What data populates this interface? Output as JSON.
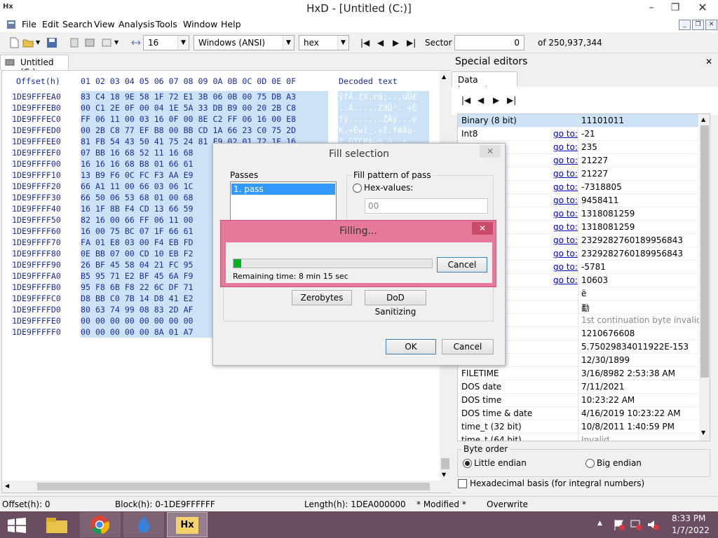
{
  "window": {
    "title": "HxD - [Untitled (C:)]",
    "app_icon_text": "Hx",
    "min": "–",
    "max": "❐",
    "close": "✕"
  },
  "menu": [
    "File",
    "Edit",
    "Search",
    "View",
    "Analysis",
    "Tools",
    "Window",
    "Help"
  ],
  "toolbar": {
    "bytes_per_row": "16",
    "charset": "Windows (ANSI)",
    "offset_base": "hex",
    "sector_label": "Sector",
    "sector_value": "0",
    "sector_total": "of 250,937,344"
  },
  "doc_tab": "Untitled (C:)",
  "hex": {
    "header_offset": "Offset(h)",
    "header_cols": "01 02 03 04 05 06 07 08 09 0A 0B 0C 0D 0E 0F",
    "header_decoded": "Decoded text",
    "rows": [
      {
        "off": "1DE9FFFEA0",
        "hex": "83 C4 18 9E 58 1F 72 E1 3B 06 0B 00 75 DB A3",
        "txt": "ÿfÄ.žX.rá;...uÛ£"
      },
      {
        "off": "1DE9FFFEB0",
        "hex": "00 C1 2E 0F 00 04 1E 5A 33 DB B9 00 20 2B C8",
        "txt": "..Á.....Z3Û¹. +È"
      },
      {
        "off": "1DE9FFFEC0",
        "hex": "FF 06 11 00 03 16 0F 00 8E C2 FF 06 16 00 E8",
        "txt": "fÿ.......ŽÂÿ...è"
      },
      {
        "off": "1DE9FFFED0",
        "hex": "00 2B C8 77 EF B8 00 BB CD 1A 66 23 C0 75 2D",
        "txt": "K.+Èwï¸.»Í.f#Àu-"
      },
      {
        "off": "1DE9FFFEE0",
        "hex": "81 FB 54 43 50 41 75 24 81 F9 02 01 72 1E 16",
        "txt": "f.ûTCPAu$.ù..r.."
      },
      {
        "off": "1DE9FFFEF0",
        "hex": "07 BB 16 68 52 11 16 68",
        "txt": ""
      },
      {
        "off": "1DE9FFFF00",
        "hex": "16 16 16 68 B8 01 66 61",
        "txt": ""
      },
      {
        "off": "1DE9FFFF10",
        "hex": "13 B9 F6 0C FC F3 AA E9",
        "txt": ""
      },
      {
        "off": "1DE9FFFF20",
        "hex": "66 A1 11 00 66 03 06 1C",
        "txt": ""
      },
      {
        "off": "1DE9FFFF30",
        "hex": "66 50 06 53 68 01 00 68",
        "txt": ""
      },
      {
        "off": "1DE9FFFF40",
        "hex": "16 1F 8B F4 CD 13 66 59",
        "txt": ""
      },
      {
        "off": "1DE9FFFF50",
        "hex": "82 16 00 66 FF 06 11 00",
        "txt": ""
      },
      {
        "off": "1DE9FFFF60",
        "hex": "16 00 75 BC 07 1F 66 61",
        "txt": ""
      },
      {
        "off": "1DE9FFFF70",
        "hex": "FA 01 E8 03 00 F4 EB FD",
        "txt": ""
      },
      {
        "off": "1DE9FFFF80",
        "hex": "0E BB 07 00 CD 10 EB F2",
        "txt": ""
      },
      {
        "off": "1DE9FFFF90",
        "hex": "26 BF 45 58 04 21 FC 95",
        "txt": ""
      },
      {
        "off": "1DE9FFFFA0",
        "hex": "B5 95 71 E2 BF 45 6A F9",
        "txt": ""
      },
      {
        "off": "1DE9FFFFB0",
        "hex": "95 F8 6B F8 22 6C DF 71",
        "txt": ""
      },
      {
        "off": "1DE9FFFFC0",
        "hex": "D8 BB C0 7B 14 D8 41 E2",
        "txt": ""
      },
      {
        "off": "1DE9FFFFD0",
        "hex": "80 63 74 99 08 83 2D AF",
        "txt": ""
      },
      {
        "off": "1DE9FFFFE0",
        "hex": "00 00 00 00 00 00 00 00",
        "txt": ""
      },
      {
        "off": "1DE9FFFFF0",
        "hex": "00 00 00 00 00 8A 01 A7",
        "txt": ""
      }
    ]
  },
  "special": {
    "title": "Special editors",
    "close": "✕",
    "tab": "Data inspector"
  },
  "inspector": {
    "goto": "go to:",
    "rows": [
      {
        "name": "Binary (8 bit)",
        "goto": false,
        "value": "11101011"
      },
      {
        "name": "Int8",
        "goto": true,
        "value": "-21"
      },
      {
        "name": "",
        "goto": true,
        "value": "235"
      },
      {
        "name": "",
        "goto": true,
        "value": "21227"
      },
      {
        "name": "",
        "goto": true,
        "value": "21227"
      },
      {
        "name": "",
        "goto": true,
        "value": "-7318805"
      },
      {
        "name": "",
        "goto": true,
        "value": "9458411"
      },
      {
        "name": "",
        "goto": true,
        "value": "1318081259"
      },
      {
        "name": "",
        "goto": true,
        "value": "1318081259"
      },
      {
        "name": "",
        "goto": true,
        "value": "2329282760189956843"
      },
      {
        "name": "",
        "goto": true,
        "value": "2329282760189956843"
      },
      {
        "name": "",
        "goto": true,
        "value": "-5781"
      },
      {
        "name": "",
        "goto": true,
        "value": "10603"
      },
      {
        "name": "char8_t",
        "goto": false,
        "value": "ë"
      },
      {
        "name": "char16_t",
        "goto": false,
        "value": "勫"
      },
      {
        "name": "point",
        "goto": false,
        "value": "1st continuation byte invalid"
      },
      {
        "name": "32)",
        "goto": false,
        "value": "1210676608"
      },
      {
        "name": "at64)",
        "goto": false,
        "value": "5.75029834011922E-153"
      },
      {
        "name": "",
        "goto": false,
        "value": "12/30/1899"
      },
      {
        "name": "FILETIME",
        "goto": false,
        "value": "3/16/8982 2:53:38 AM"
      },
      {
        "name": "DOS date",
        "goto": false,
        "value": "7/11/2021"
      },
      {
        "name": "DOS time",
        "goto": false,
        "value": "10:23:22 AM"
      },
      {
        "name": "DOS time & date",
        "goto": false,
        "value": "4/16/2019 10:23:22 AM"
      },
      {
        "name": "time_t (32 bit)",
        "goto": false,
        "value": "10/8/2011 1:40:59 PM"
      },
      {
        "name": "time_t (64 bit)",
        "goto": false,
        "value": "Invalid"
      }
    ],
    "byte_order_label": "Byte order",
    "little_endian": "Little endian",
    "big_endian": "Big endian",
    "hex_basis": "Hexadecimal basis (for integral numbers)"
  },
  "fill_dialog": {
    "title": "Fill selection",
    "passes_label": "Passes",
    "pass_item": "1. pass",
    "pattern_label": "Fill pattern of pass",
    "hex_values_label": "Hex-values:",
    "hex_value": "00",
    "zerobytes": "Zerobytes",
    "dod": "DoD Sanitizing",
    "ok": "OK",
    "cancel": "Cancel"
  },
  "filling_dialog": {
    "title": "Filling...",
    "remaining": "Remaining time: 8 min 15 sec",
    "cancel": "Cancel",
    "progress": 0.04
  },
  "statusbar": {
    "offset": "Offset(h): 0",
    "block": "Block(h): 0-1DE9FFFFFF",
    "length": "Length(h): 1DEA000000",
    "modified": "* Modified *",
    "mode": "Overwrite"
  },
  "taskbar": {
    "time": "8:33 PM",
    "date": "1/7/2022"
  },
  "colors": {
    "selection": "#cce3f7",
    "offset_text": "#1c2ca0",
    "filling_frame": "#e6799a",
    "taskbar": "#6b4d61",
    "progress": "#06b025"
  }
}
